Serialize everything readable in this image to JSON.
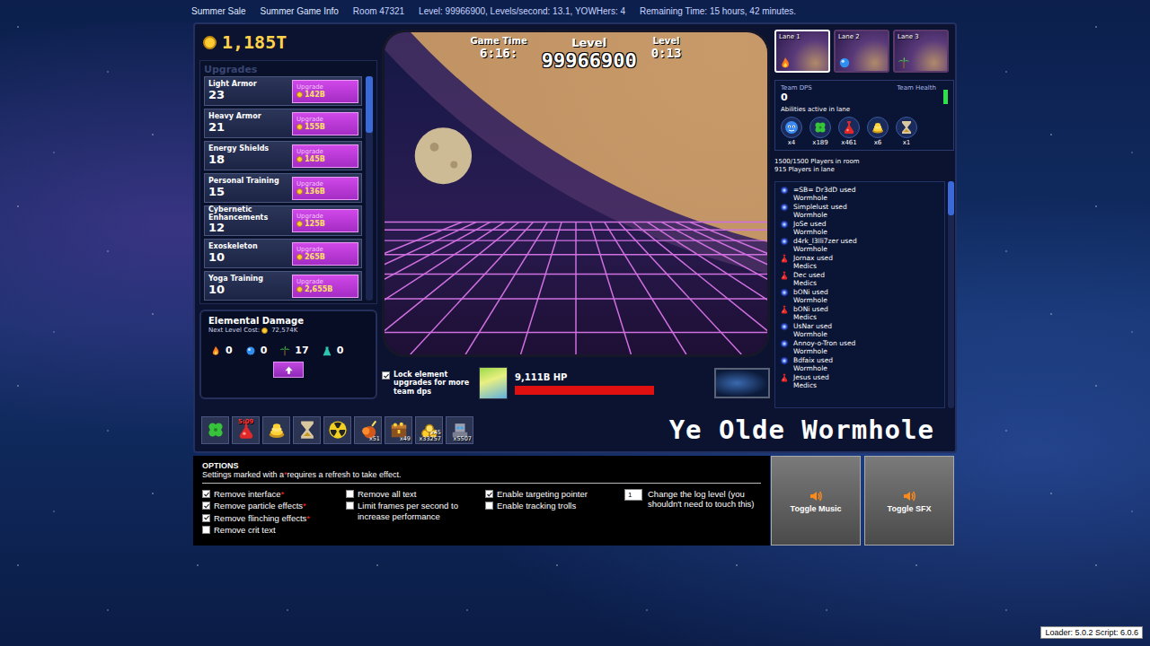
{
  "top_bar": {
    "links": [
      "Summer Sale",
      "Summer Game Info"
    ],
    "room": "Room 47321",
    "stats": "Level: 99966900, Levels/second: 13.1, YOWHers: 4",
    "remaining": "Remaining Time: 15 hours, 42 minutes."
  },
  "gold": "1,185T",
  "upgrades": {
    "title": "Upgrades",
    "scroll_level": 0.25,
    "items": [
      {
        "name": "Light Armor",
        "level": "23",
        "button": "Upgrade",
        "cost": "142B"
      },
      {
        "name": "Heavy Armor",
        "level": "21",
        "button": "Upgrade",
        "cost": "155B"
      },
      {
        "name": "Energy Shields",
        "level": "18",
        "button": "Upgrade",
        "cost": "145B"
      },
      {
        "name": "Personal Training",
        "level": "15",
        "button": "Upgrade",
        "cost": "136B"
      },
      {
        "name": "Cybernetic Enhancements",
        "level": "12",
        "button": "Upgrade",
        "cost": "125B"
      },
      {
        "name": "Exoskeleton",
        "level": "10",
        "button": "Upgrade",
        "cost": "265B"
      },
      {
        "name": "Yoga Training",
        "level": "10",
        "button": "Upgrade",
        "cost": "2,655B"
      }
    ]
  },
  "elemental": {
    "title": "Elemental Damage",
    "cost_label": "Next Level Cost:",
    "cost": "72,574K",
    "elements": [
      {
        "kind": "fire",
        "value": "0"
      },
      {
        "kind": "water",
        "value": "0"
      },
      {
        "kind": "air",
        "value": "17"
      },
      {
        "kind": "earth",
        "value": "0"
      }
    ]
  },
  "hud": {
    "game_time_label": "Game Time",
    "game_time": "6:16:",
    "level_label": "Level",
    "level": "99966900",
    "level_time_label": "Level",
    "level_time": "0:13"
  },
  "lock": {
    "label": "Lock element upgrades for more team dps",
    "checked": true
  },
  "enemy": {
    "hp": "9,111B HP",
    "level": 1,
    "name": "Ye Olde Wormhole"
  },
  "abilities": [
    {
      "kind": "clover",
      "cooldown": "",
      "badges": []
    },
    {
      "kind": "medic",
      "cooldown": "5:09",
      "badges": []
    },
    {
      "kind": "gold_rain",
      "cooldown": "",
      "badges": []
    },
    {
      "kind": "hourglass",
      "cooldown": "",
      "badges": []
    },
    {
      "kind": "nuke",
      "cooldown": "",
      "badges": []
    },
    {
      "kind": "cluster",
      "cooldown": "",
      "badges": [
        "x51"
      ]
    },
    {
      "kind": "treasure",
      "cooldown": "",
      "badges": [
        "x49"
      ]
    },
    {
      "kind": "gold_pile",
      "cooldown": "",
      "badges": [
        "x45",
        "x33257"
      ]
    },
    {
      "kind": "robot",
      "cooldown": "",
      "badges": [
        "x5507"
      ]
    }
  ],
  "lanes": [
    {
      "label": "Lane 1",
      "selected": true,
      "element": "fire"
    },
    {
      "label": "Lane 2",
      "selected": false,
      "element": "water"
    },
    {
      "label": "Lane 3",
      "selected": false,
      "element": "air"
    }
  ],
  "team": {
    "dps_label": "Team DPS",
    "dps": "0",
    "health_label": "Team Health",
    "health_level": 1,
    "active_label": "Abilities active in lane",
    "active": [
      {
        "kind": "morale",
        "count": "x4"
      },
      {
        "kind": "clover",
        "count": "x189"
      },
      {
        "kind": "medic",
        "count": "x461"
      },
      {
        "kind": "gold_rain",
        "count": "x6"
      },
      {
        "kind": "hourglass",
        "count": "x1"
      }
    ]
  },
  "players": {
    "room": "1500/1500 Players in room",
    "lane": "915 Players in lane"
  },
  "log": {
    "scroll_level": 0.15,
    "entries": [
      {
        "text": "=SB= Dr3dD used",
        "ability": "Wormhole",
        "kind": "wormhole"
      },
      {
        "text": "Simplelust used",
        "ability": "Wormhole",
        "kind": "wormhole"
      },
      {
        "text": "JoSe used",
        "ability": "Wormhole",
        "kind": "wormhole"
      },
      {
        "text": "d4rk_l3lli7zer used",
        "ability": "Wormhole",
        "kind": "wormhole"
      },
      {
        "text": "Jornax used",
        "ability": "Medics",
        "kind": "medic"
      },
      {
        "text": "Dec used",
        "ability": "Medics",
        "kind": "medic"
      },
      {
        "text": "bONi used",
        "ability": "Wormhole",
        "kind": "wormhole"
      },
      {
        "text": "bONi used",
        "ability": "Medics",
        "kind": "medic"
      },
      {
        "text": "UsNar used",
        "ability": "Wormhole",
        "kind": "wormhole"
      },
      {
        "text": "Annoy-o-Tron used",
        "ability": "Wormhole",
        "kind": "wormhole"
      },
      {
        "text": "Bdfaix used",
        "ability": "Wormhole",
        "kind": "wormhole"
      },
      {
        "text": "Jesus used",
        "ability": "Medics",
        "kind": "medic"
      }
    ]
  },
  "sound": [
    "Toggle Music",
    "Toggle SFX"
  ],
  "options": {
    "title": "OPTIONS",
    "note": [
      "Settings marked with a",
      "*",
      "requires a refresh to take effect."
    ],
    "columns": [
      [
        {
          "label": "Remove interface",
          "mark": "*",
          "checked": true
        },
        {
          "label": "Remove particle effects",
          "mark": "*",
          "checked": true
        },
        {
          "label": "Remove flinching effects",
          "mark": "*",
          "checked": true
        },
        {
          "label": "Remove crit text",
          "mark": "",
          "checked": false
        }
      ],
      [
        {
          "label": "Remove all text",
          "mark": "",
          "checked": false
        },
        {
          "label": "Limit frames per second to increase performance",
          "mark": "",
          "checked": false
        }
      ],
      [
        {
          "label": "Enable targeting pointer",
          "mark": "",
          "checked": true
        },
        {
          "label": "Enable tracking trolls",
          "mark": "",
          "checked": false
        }
      ]
    ],
    "log_level": {
      "value": "1",
      "label": "Change the log level (you shouldn't need to touch this)"
    }
  },
  "loader": "Loader: 5.0.2 Script: 6.0.6"
}
